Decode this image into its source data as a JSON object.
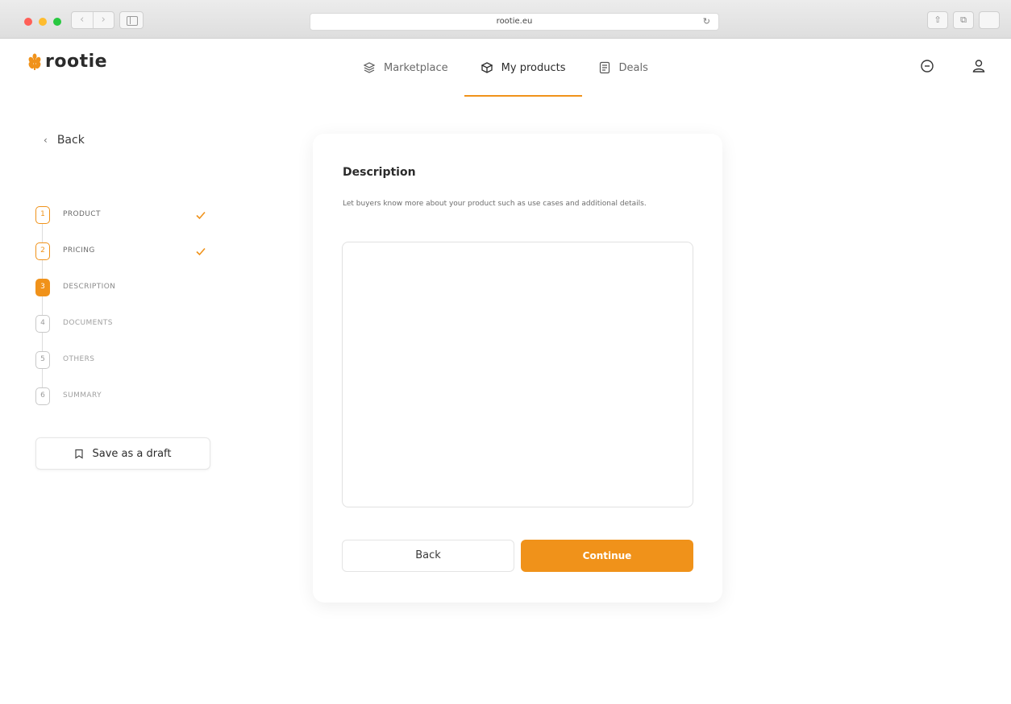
{
  "browser": {
    "url": "rootie.eu",
    "reload_glyph": "↻",
    "back_glyph": "‹",
    "forward_glyph": "›",
    "share_glyph": "⇧",
    "tabs_glyph": "⧉"
  },
  "app": {
    "brand": "rootie",
    "accent_color": "#f0921a"
  },
  "nav": {
    "items": [
      {
        "label": "Marketplace",
        "icon": "layers-icon",
        "active": false
      },
      {
        "label": "My products",
        "icon": "box-icon",
        "active": true
      },
      {
        "label": "Deals",
        "icon": "document-icon",
        "active": false
      }
    ]
  },
  "header_icons": [
    "chat-icon",
    "user-icon"
  ],
  "sidebar": {
    "back_label": "Back",
    "back_glyph": "‹",
    "steps": [
      {
        "number": "1",
        "label": "PRODUCT",
        "state": "done"
      },
      {
        "number": "2",
        "label": "PRICING",
        "state": "done"
      },
      {
        "number": "3",
        "label": "DESCRIPTION",
        "state": "current"
      },
      {
        "number": "4",
        "label": "DOCUMENTS",
        "state": "todo"
      },
      {
        "number": "5",
        "label": "OTHERS",
        "state": "todo"
      },
      {
        "number": "6",
        "label": "SUMMARY",
        "state": "todo"
      }
    ],
    "save_draft_label": "Save as a draft"
  },
  "form": {
    "title": "Description",
    "help_text": "Let buyers know more about your product such as use cases and additional details.",
    "description_value": "",
    "back_button": "Back",
    "continue_button": "Continue"
  }
}
